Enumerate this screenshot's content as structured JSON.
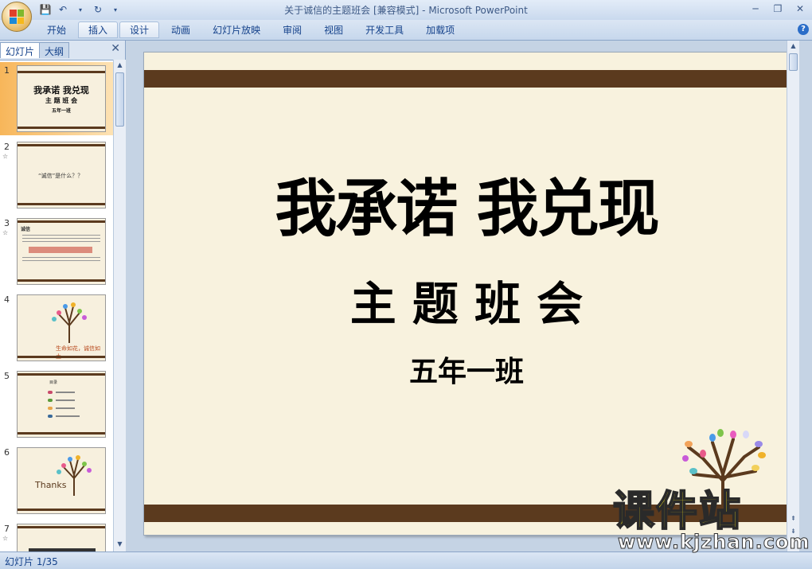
{
  "window": {
    "title": "关于诚信的主题班会 [兼容模式]",
    "separator": " - ",
    "app_name": "Microsoft PowerPoint"
  },
  "ribbon": {
    "tabs": [
      "开始",
      "插入",
      "设计",
      "动画",
      "幻灯片放映",
      "审阅",
      "视图",
      "开发工具",
      "加载项"
    ]
  },
  "left_panel": {
    "tabs": [
      "幻灯片",
      "大纲"
    ],
    "slides": [
      {
        "num": "1",
        "title": "我承诺 我兑现",
        "sub": "主 题 班 会",
        "sub2": "五年一班"
      },
      {
        "num": "2",
        "text": "“诚信”是什么？？"
      },
      {
        "num": "3",
        "text": "诚信"
      },
      {
        "num": "4",
        "text": "生命如花，诚信如土"
      },
      {
        "num": "5",
        "text": "目录"
      },
      {
        "num": "6",
        "text": "Thanks"
      },
      {
        "num": "7",
        "text": ""
      }
    ]
  },
  "slide": {
    "title": "我承诺 我兑现",
    "subtitle": "主 题 班 会",
    "class_name": "五年一班",
    "bg_color": "#f8f2de",
    "bar_color": "#5b3a1e"
  },
  "watermark": {
    "cn": "课件站",
    "en": "www.kjzhan.com"
  },
  "status": {
    "slide_counter": "幻灯片 1/35"
  }
}
